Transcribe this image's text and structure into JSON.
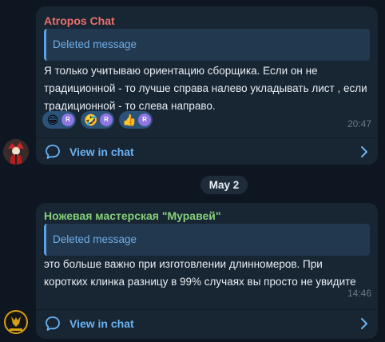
{
  "messages": [
    {
      "sender": "Atropos Chat",
      "reply_preview": "Deleted message",
      "text_line1": "Я только учитываю ориентацию сборщика. Если он не",
      "text_line2": "традиционной - то лучше справа налево укладывать лист , если",
      "text_line3": "традиционной - то слева направо.",
      "time": "20:47",
      "reactions": [
        {
          "emoji": "😁",
          "user": "R"
        },
        {
          "emoji": "🤣",
          "user": "R"
        },
        {
          "emoji": "👍",
          "user": "R"
        }
      ],
      "view_label": "View in chat"
    },
    {
      "sender": "Ножевая мастерская \"Муравей\"",
      "reply_preview": "Deleted message",
      "text_line1": "это больше важно при изготовлении длинномеров. При",
      "text_line2": "коротких клинка разницу в 99% случаях вы просто не увидите",
      "time": "14:46",
      "view_label": "View in chat"
    }
  ],
  "date_separator": "May 2",
  "colors": {
    "background": "#0e1621",
    "bubble": "#182533",
    "accent": "#6ab3f3",
    "sender1": "#ec6f6a",
    "sender2": "#86d07a"
  },
  "icons": {
    "chat": "chat-bubble-icon",
    "chevron": "chevron-right-icon"
  }
}
